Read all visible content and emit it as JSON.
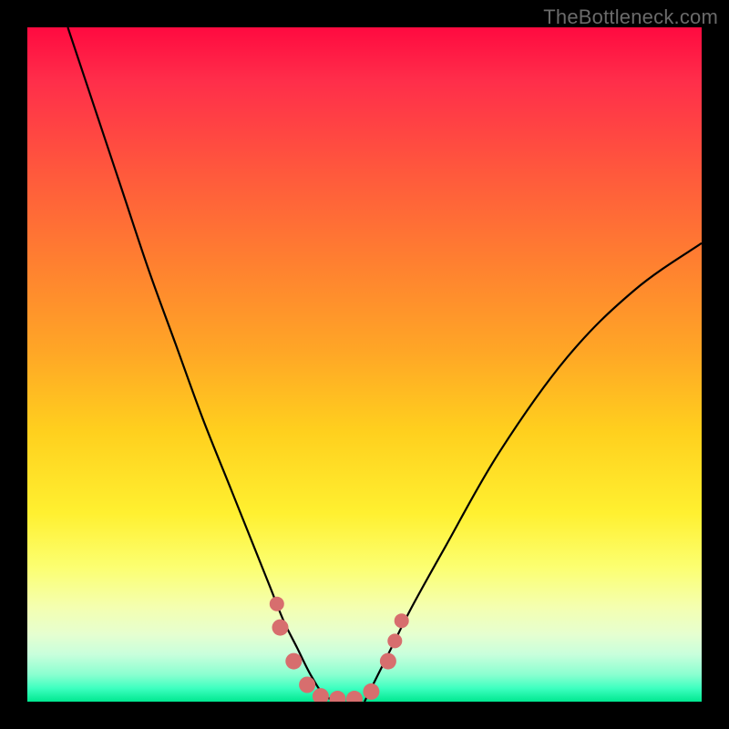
{
  "watermark": "TheBottleneck.com",
  "chart_data": {
    "type": "line",
    "title": "",
    "xlabel": "",
    "ylabel": "",
    "xlim": [
      0,
      100
    ],
    "ylim": [
      0,
      100
    ],
    "series": [
      {
        "name": "left-curve",
        "x": [
          6,
          10,
          14,
          18,
          22,
          26,
          30,
          34,
          36,
          38,
          40,
          42,
          44,
          46
        ],
        "values": [
          100,
          88,
          76,
          64,
          53,
          42,
          32,
          22,
          17,
          12,
          8,
          4,
          1,
          0
        ]
      },
      {
        "name": "right-curve",
        "x": [
          50,
          52,
          54,
          57,
          62,
          70,
          80,
          90,
          100
        ],
        "values": [
          0,
          4,
          8,
          14,
          23,
          37,
          51,
          61,
          68
        ]
      }
    ],
    "markers": {
      "color": "#d76e6e",
      "points": [
        {
          "x": 37.0,
          "y": 14.5,
          "r": 8
        },
        {
          "x": 37.5,
          "y": 11.0,
          "r": 9
        },
        {
          "x": 39.5,
          "y": 6.0,
          "r": 9
        },
        {
          "x": 41.5,
          "y": 2.5,
          "r": 9
        },
        {
          "x": 43.5,
          "y": 0.8,
          "r": 9
        },
        {
          "x": 46.0,
          "y": 0.4,
          "r": 9
        },
        {
          "x": 48.5,
          "y": 0.4,
          "r": 9
        },
        {
          "x": 51.0,
          "y": 1.5,
          "r": 9
        },
        {
          "x": 53.5,
          "y": 6.0,
          "r": 9
        },
        {
          "x": 54.5,
          "y": 9.0,
          "r": 8
        },
        {
          "x": 55.5,
          "y": 12.0,
          "r": 8
        }
      ]
    },
    "bottom_band": {
      "from_y": 0,
      "to_y": 3
    }
  }
}
